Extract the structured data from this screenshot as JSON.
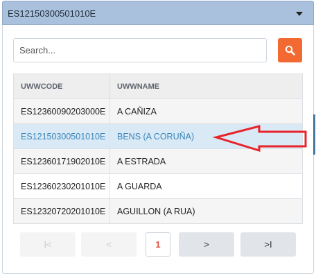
{
  "select": {
    "value": "ES12150300501010E"
  },
  "search": {
    "placeholder": "Search..."
  },
  "table": {
    "columns": [
      "UWWCODE",
      "UWWNAME"
    ],
    "rows": [
      {
        "code": "ES12360090203000E",
        "name": "A CAÑIZA"
      },
      {
        "code": "ES12150300501010E",
        "name": "BENS (A CORUÑA)"
      },
      {
        "code": "ES12360171902010E",
        "name": "A ESTRADA"
      },
      {
        "code": "ES12360230201010E",
        "name": "A GUARDA"
      },
      {
        "code": "ES12320720201010E",
        "name": "AGUILLON (A RUA)"
      }
    ],
    "selected_row": 1
  },
  "pagination": {
    "first": "I<",
    "prev": "<",
    "current_page": "1",
    "next": ">",
    "last": ">I"
  },
  "colors": {
    "select_bg": "#a9c1dd",
    "search_button": "#f26a31",
    "selected_row_bg": "#d9e9f6",
    "selected_row_text": "#3b86b8",
    "annotation_arrow": "#e8232a",
    "current_page_text": "#e0503a"
  },
  "icons": {
    "select_toggle": "caret-down-icon",
    "search_button": "magnifier-icon",
    "annotation": "red-arrow-left-icon"
  }
}
